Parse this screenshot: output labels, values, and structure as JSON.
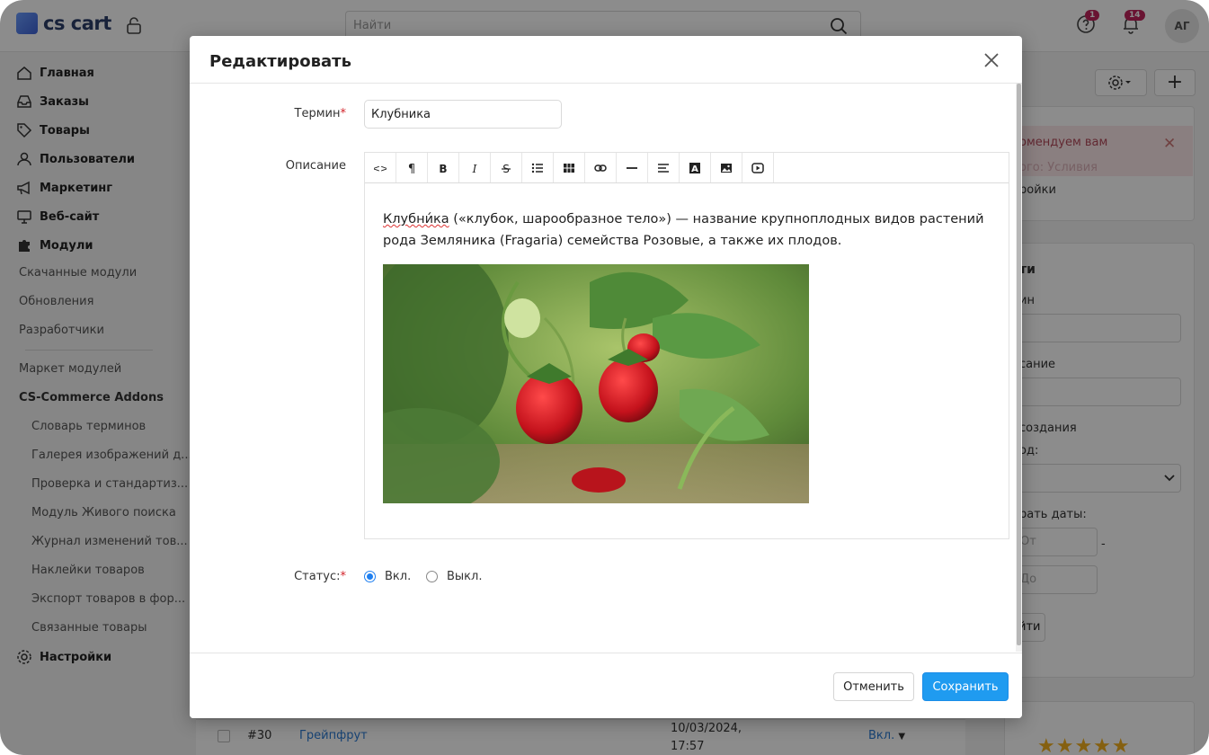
{
  "app": {
    "logo_text": "cs cart",
    "search_placeholder": "Найти",
    "help_badge": "1",
    "notifications_badge": "14",
    "avatar_initials": "АГ"
  },
  "sidebar": {
    "main": [
      {
        "label": "Главная",
        "icon": "home-icon"
      },
      {
        "label": "Заказы",
        "icon": "inbox-icon"
      },
      {
        "label": "Товары",
        "icon": "tag-icon"
      },
      {
        "label": "Пользователи",
        "icon": "user-icon"
      },
      {
        "label": "Маркетинг",
        "icon": "megaphone-icon"
      },
      {
        "label": "Веб-сайт",
        "icon": "monitor-icon"
      },
      {
        "label": "Модули",
        "icon": "puzzle-icon"
      }
    ],
    "modules_sub": [
      "Скачанные модули",
      "Обновления",
      "Разработчики"
    ],
    "market": "Маркет модулей",
    "group": "CS-Commerce Addons",
    "group_items": [
      "Словарь терминов",
      "Галерея изображений д...",
      "Проверка и стандартиз...",
      "Модуль Живого поиска",
      "Журнал изменений тов...",
      "Наклейки товаров",
      "Экспорт товаров в фор...",
      "Связанные товары"
    ],
    "settings": "Настройки"
  },
  "background": {
    "notice": "омендуем вам",
    "notice_sub": "ого: Усливия",
    "panel_text": "ройки",
    "filter_title": "ти",
    "filter_labels": [
      "ин",
      "сание",
      "создания",
      "од:",
      "рать даты:"
    ],
    "filter_from": "От",
    "filter_to": "До",
    "filter_button": "йти",
    "row": {
      "id": "#30",
      "name": "Грейпфрут",
      "date": "10/03/2024, 17:57",
      "status": "Вкл."
    },
    "stars": "★★★★★"
  },
  "modal": {
    "title": "Редактировать",
    "term_label": "Термин",
    "term_value": "Клубника",
    "description_label": "Описание",
    "toolbar": [
      {
        "name": "code-view-button",
        "icon": "code-icon",
        "text": "<>"
      },
      {
        "name": "paragraph-button",
        "icon": "pilcrow-icon",
        "text": "¶"
      },
      {
        "name": "bold-button",
        "icon": "bold-icon",
        "text": "B"
      },
      {
        "name": "italic-button",
        "icon": "italic-icon",
        "text": "I"
      },
      {
        "name": "strikethrough-button",
        "icon": "strike-icon",
        "text": "S"
      },
      {
        "name": "list-button",
        "icon": "list-icon",
        "text": ""
      },
      {
        "name": "table-button",
        "icon": "table-icon",
        "text": ""
      },
      {
        "name": "link-button",
        "icon": "link-icon",
        "text": ""
      },
      {
        "name": "horizontal-rule-button",
        "icon": "hr-icon",
        "text": ""
      },
      {
        "name": "align-button",
        "icon": "align-icon",
        "text": ""
      },
      {
        "name": "font-color-button",
        "icon": "font-color-icon",
        "text": ""
      },
      {
        "name": "image-button",
        "icon": "image-icon",
        "text": ""
      },
      {
        "name": "video-button",
        "icon": "video-icon",
        "text": ""
      }
    ],
    "description_word": "Клубни́ка",
    "description_rest": " («клубок, шарообразное тело») — название крупноплодных видов растений рода Земляника (Fragaria) семейства Розовые, а также их плодов.",
    "status_label": "Статус:",
    "status_on": "Вкл.",
    "status_off": "Выкл.",
    "cancel": "Отменить",
    "save": "Сохранить"
  },
  "colors": {
    "accent": "#1f9bf0",
    "required": "#d2232a",
    "link": "#2b7bd4"
  }
}
